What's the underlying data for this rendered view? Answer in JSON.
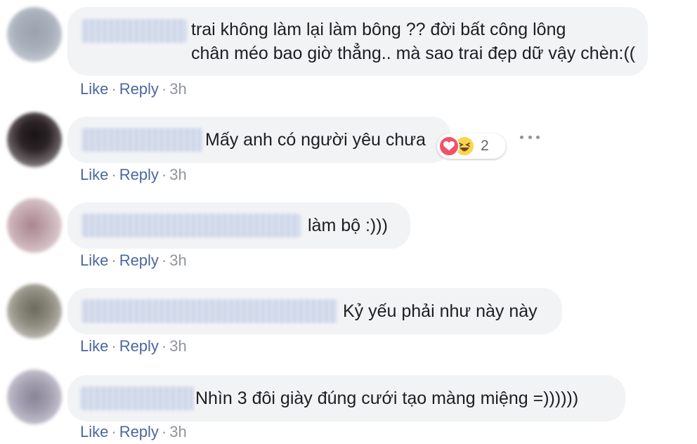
{
  "comments": [
    {
      "text": "trai không làm lại làm bông ?? đời bất công lông\nchân méo bao giờ thẳng.. mà sao trai đẹp dữ vậy chèn:((",
      "like": "Like",
      "reply": "Reply",
      "time": "3h"
    },
    {
      "text": "Mấy anh có người yêu chưa",
      "like": "Like",
      "reply": "Reply",
      "time": "3h",
      "reactions": {
        "count": "2",
        "icons": [
          "love-icon",
          "haha-icon"
        ]
      }
    },
    {
      "text": "làm bộ :)))",
      "like": "Like",
      "reply": "Reply",
      "time": "3h"
    },
    {
      "text": "Kỷ yếu phải như này này",
      "like": "Like",
      "reply": "Reply",
      "time": "3h"
    },
    {
      "text": "Nhìn 3 đôi giày đúng cưới tạo màng miệng =))))))",
      "like": "Like",
      "reply": "Reply",
      "time": "3h"
    }
  ],
  "separator": "·",
  "colors": {
    "link": "#4b67a1",
    "meta": "#90949c",
    "bubble": "#f2f3f5",
    "love": "#f25268",
    "haha": "#fcd34f"
  }
}
